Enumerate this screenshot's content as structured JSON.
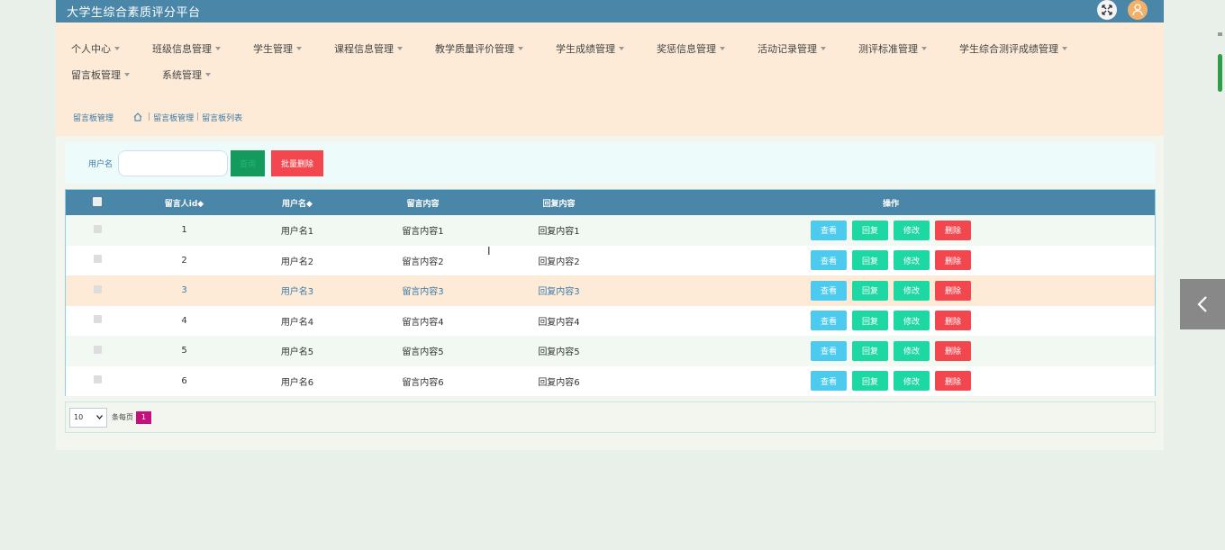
{
  "app": {
    "title": "大学生综合素质评分平台"
  },
  "nav": [
    {
      "label": "个人中心"
    },
    {
      "label": "班级信息管理"
    },
    {
      "label": "学生管理"
    },
    {
      "label": "课程信息管理"
    },
    {
      "label": "教学质量评价管理"
    },
    {
      "label": "学生成绩管理"
    },
    {
      "label": "奖惩信息管理"
    },
    {
      "label": "活动记录管理"
    },
    {
      "label": "测评标准管理"
    },
    {
      "label": "学生综合测评成绩管理"
    },
    {
      "label": "留言板管理"
    },
    {
      "label": "系统管理"
    }
  ],
  "breadcrumb": {
    "title": "留言板管理",
    "path1": "留言板管理",
    "path2": "留言板列表",
    "sep": "|"
  },
  "search": {
    "label": "用户名",
    "value": "",
    "search_btn": "查询",
    "batch_delete_btn": "批量删除"
  },
  "table": {
    "headers": {
      "id": "留言人id◆",
      "username": "用户名◆",
      "content": "留言内容",
      "reply": "回复内容",
      "actions": "操作"
    },
    "rows": [
      {
        "id": "1",
        "username": "用户名1",
        "content": "留言内容1",
        "reply": "回复内容1"
      },
      {
        "id": "2",
        "username": "用户名2",
        "content": "留言内容2",
        "reply": "回复内容2"
      },
      {
        "id": "3",
        "username": "用户名3",
        "content": "留言内容3",
        "reply": "回复内容3"
      },
      {
        "id": "4",
        "username": "用户名4",
        "content": "留言内容4",
        "reply": "回复内容4"
      },
      {
        "id": "5",
        "username": "用户名5",
        "content": "留言内容5",
        "reply": "回复内容5"
      },
      {
        "id": "6",
        "username": "用户名6",
        "content": "留言内容6",
        "reply": "回复内容6"
      }
    ],
    "action_labels": {
      "view": "查看",
      "reply": "回复",
      "edit": "修改",
      "delete": "删除"
    }
  },
  "pager": {
    "page_size": "10",
    "unit": "条每页",
    "current_page": "1"
  },
  "colors": {
    "header": "#4a86a8",
    "nav_bg": "#fdebd8",
    "danger": "#f3474f",
    "success": "#1ed8a4",
    "info": "#4ccbef",
    "page_active": "#c4107a"
  }
}
